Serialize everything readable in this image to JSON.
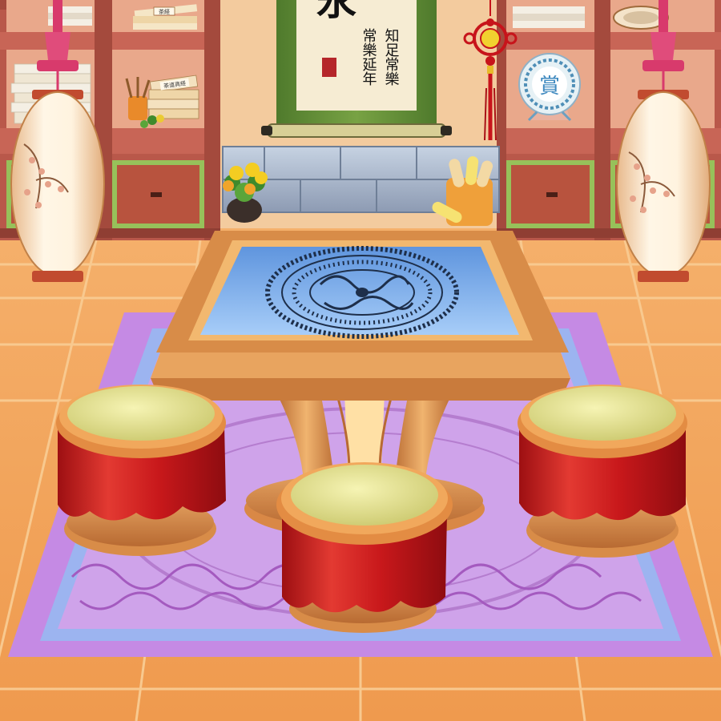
{
  "scene": {
    "type": "chinese-tea-room",
    "scroll": {
      "top_char": "永",
      "line1": "知足常樂",
      "line2": "常樂延年"
    },
    "plate_char": "賞",
    "book_label_left": "茶経",
    "book_label_shelf": "茶道真経"
  },
  "colors": {
    "wall": "#f0c597",
    "floor": "#f2a35c",
    "shelf": "#b9584a",
    "rug_outer": "#c58ae4",
    "rug_inner": "#9cb4f0",
    "table_top": "#7fb0f0",
    "stool_cloth": "#d21f1f",
    "stool_seat": "#e9e793",
    "lantern": "#fbe8cc"
  }
}
